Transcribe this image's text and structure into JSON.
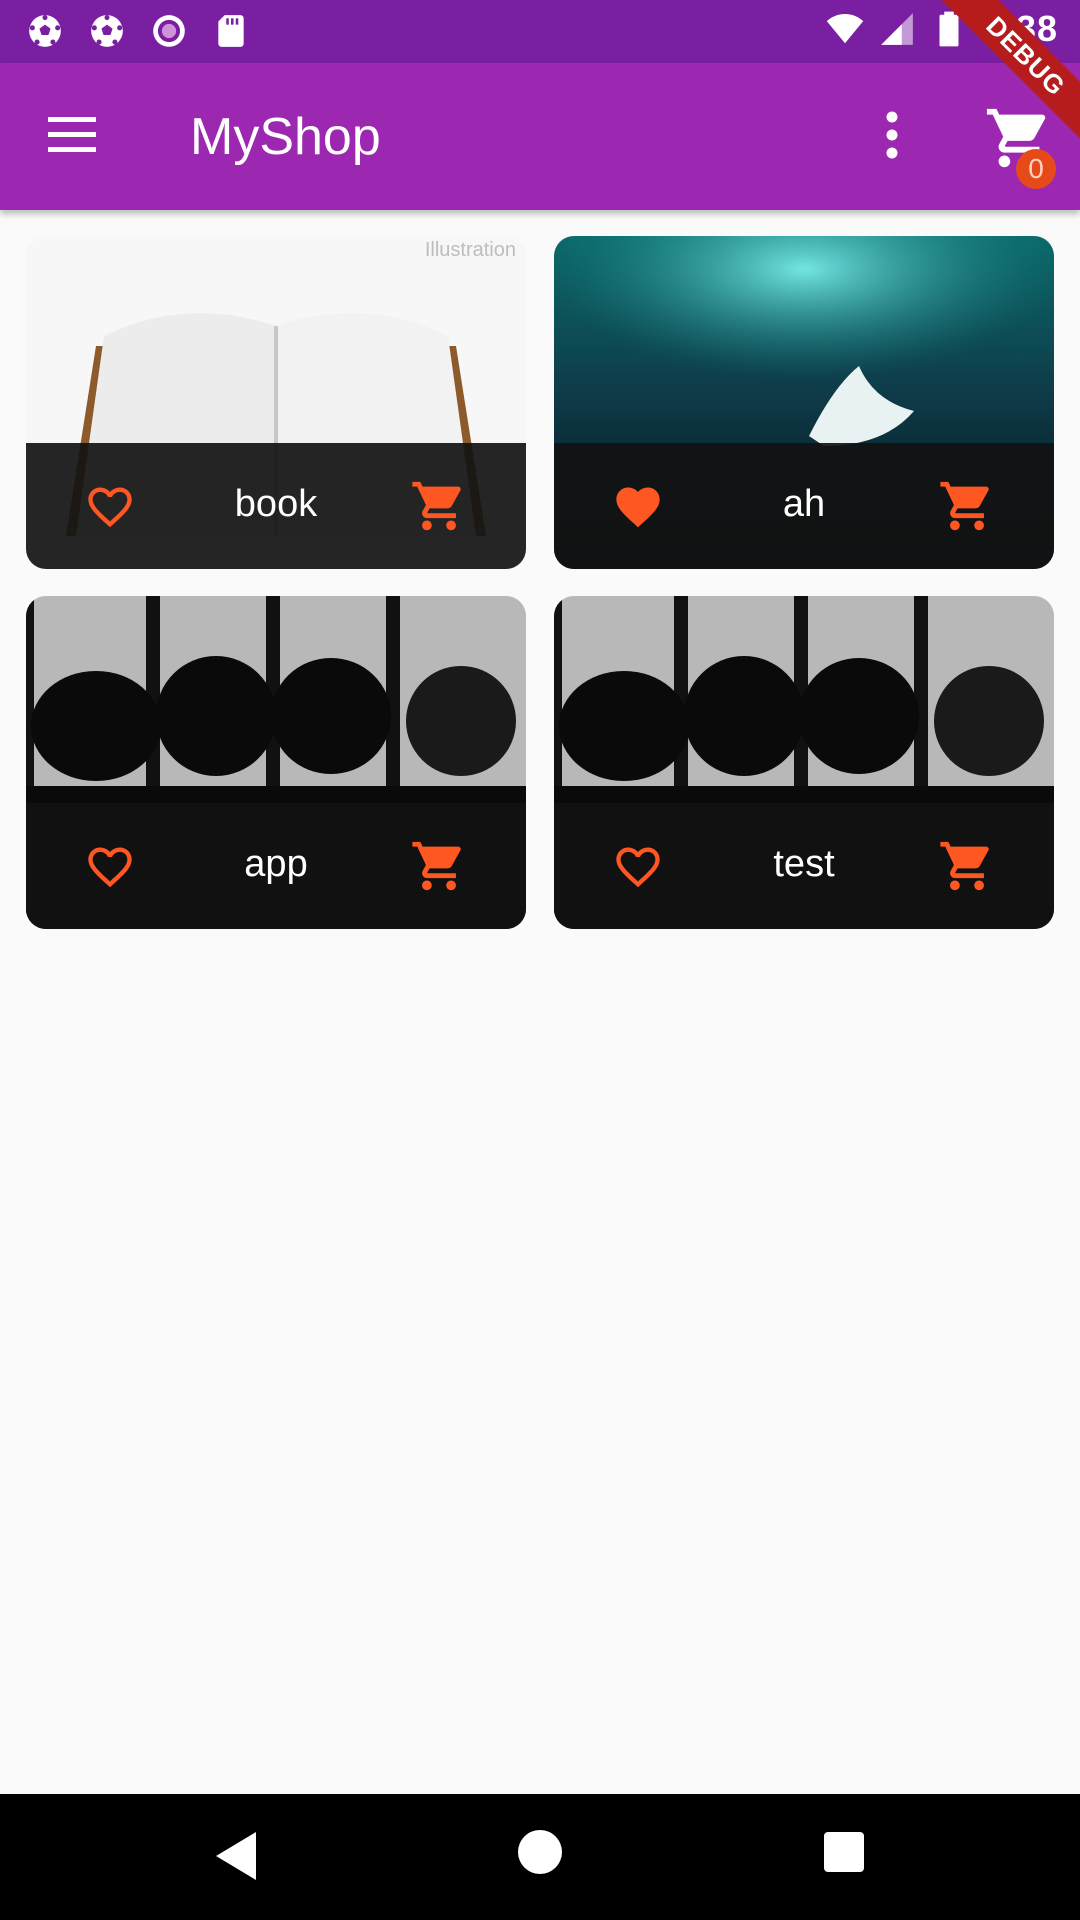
{
  "status_bar": {
    "time": "1:38",
    "left_icons": [
      "soccer-ball-icon",
      "soccer-ball-icon",
      "circle-record-icon",
      "sd-card-icon"
    ],
    "right_icons": [
      "wifi-icon",
      "signal-icon",
      "battery-icon"
    ]
  },
  "app_bar": {
    "title": "MyShop",
    "cart_count": "0",
    "debug_label": "DEBUG"
  },
  "colors": {
    "status_bar": "#7b1fa2",
    "app_bar": "#9c27b0",
    "accent": "#ff5722",
    "background": "#fafafa"
  },
  "products": [
    {
      "title": "book",
      "favorite": false,
      "image": "open book illustration",
      "image_caption": "Illustration"
    },
    {
      "title": "ah",
      "favorite": true,
      "image": "aurora with paper boat"
    },
    {
      "title": "app",
      "favorite": false,
      "image": "tree silhouettes panels"
    },
    {
      "title": "test",
      "favorite": false,
      "image": "tree silhouettes panels"
    }
  ]
}
